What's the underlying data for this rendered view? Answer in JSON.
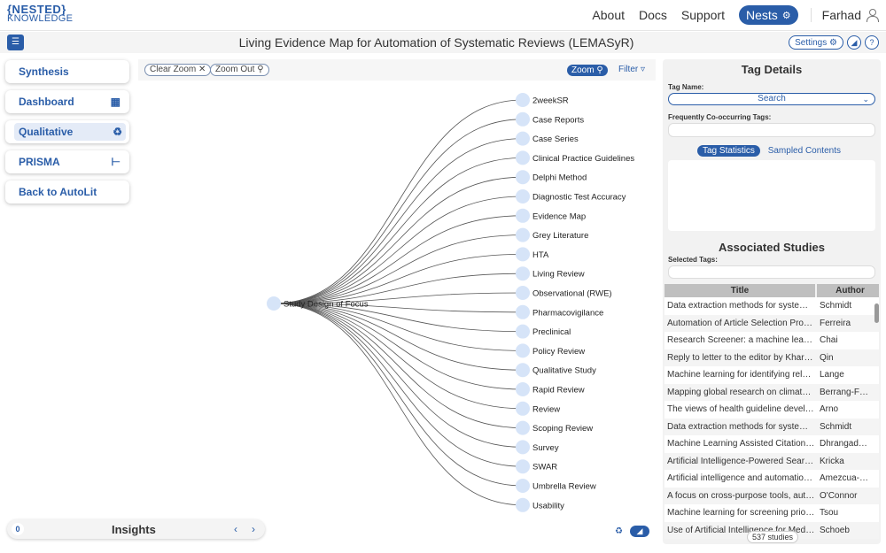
{
  "logo": {
    "line1": "{NESTED}",
    "line2": "KNOWLEDGE"
  },
  "nav": {
    "about": "About",
    "docs": "Docs",
    "support": "Support",
    "nests": "Nests",
    "user": "Farhad"
  },
  "titlebar": {
    "title": "Living Evidence Map for Automation of Systematic Reviews (LEMASyR)",
    "settings": "Settings"
  },
  "sidebar": {
    "items": [
      {
        "label": "Synthesis"
      },
      {
        "label": "Dashboard"
      },
      {
        "label": "Qualitative"
      },
      {
        "label": "PRISMA"
      },
      {
        "label": "Back to AutoLit"
      }
    ]
  },
  "canvas": {
    "clear_zoom": "Clear Zoom",
    "zoom_out": "Zoom Out",
    "zoom": "Zoom",
    "filter": "Filter",
    "root": "Study Design of Focus",
    "children": [
      "2weekSR",
      "Case Reports",
      "Case Series",
      "Clinical Practice Guidelines",
      "Delphi Method",
      "Diagnostic Test Accuracy",
      "Evidence Map",
      "Grey Literature",
      "HTA",
      "Living Review",
      "Observational (RWE)",
      "Pharmacovigilance",
      "Preclinical",
      "Policy Review",
      "Qualitative Study",
      "Rapid Review",
      "Review",
      "Scoping Review",
      "Survey",
      "SWAR",
      "Umbrella Review",
      "Usability"
    ]
  },
  "insights": {
    "count": "0",
    "title": "Insights"
  },
  "panel": {
    "tag_details": "Tag Details",
    "tag_name_label": "Tag Name:",
    "search": "Search",
    "cooccur_label": "Frequently Co-occurring Tags:",
    "tab_stats": "Tag Statistics",
    "tab_samples": "Sampled Contents",
    "associated": "Associated Studies",
    "selected_label": "Selected Tags:",
    "col_title": "Title",
    "col_author": "Author",
    "rows": [
      {
        "title": "Data extraction methods for systematic reviews",
        "author": "Schmidt"
      },
      {
        "title": "Automation of Article Selection Process",
        "author": "Ferreira"
      },
      {
        "title": "Research Screener: a machine learning tool",
        "author": "Chai"
      },
      {
        "title": "Reply to letter to the editor by Kharazmi",
        "author": "Qin"
      },
      {
        "title": "Machine learning for identifying relevant",
        "author": "Lange"
      },
      {
        "title": "Mapping global research on climate change",
        "author": "Berrang-Ford"
      },
      {
        "title": "The views of health guideline developers",
        "author": "Arno"
      },
      {
        "title": "Data extraction methods for systematic reviews",
        "author": "Schmidt"
      },
      {
        "title": "Machine Learning Assisted Citation Screening",
        "author": "Dhrangadhariya"
      },
      {
        "title": "Artificial Intelligence-Powered Search Tools",
        "author": "Kricka"
      },
      {
        "title": "Artificial intelligence and automation of systematic reviews",
        "author": "Amezcua-Prieto"
      },
      {
        "title": "A focus on cross-purpose tools, automated",
        "author": "O'Connor"
      },
      {
        "title": "Machine learning for screening prioritization",
        "author": "Tsou"
      },
      {
        "title": "Use of Artificial Intelligence for Medical",
        "author": "Schoeb"
      }
    ],
    "count": "537 studies"
  }
}
